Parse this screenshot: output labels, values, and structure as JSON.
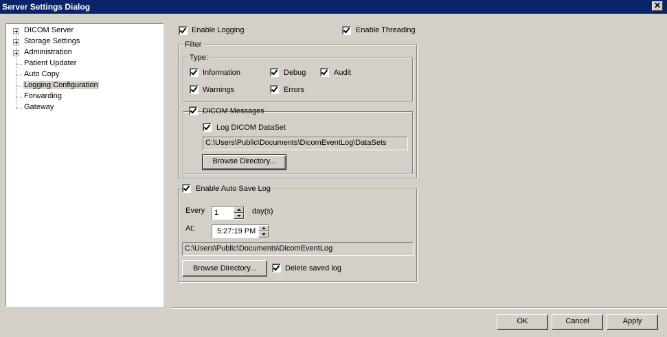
{
  "window": {
    "title": "Server Settings Dialog",
    "close": "✕"
  },
  "tree": {
    "items": [
      {
        "label": "DICOM Server",
        "expandable": true
      },
      {
        "label": "Storage Settings",
        "expandable": true
      },
      {
        "label": "Administration",
        "expandable": true
      },
      {
        "label": "Patient Updater",
        "expandable": false
      },
      {
        "label": "Auto Copy",
        "expandable": false
      },
      {
        "label": "Logging Configuration",
        "expandable": false,
        "selected": true
      },
      {
        "label": "Forwarding",
        "expandable": false
      },
      {
        "label": "Gateway",
        "expandable": false
      }
    ]
  },
  "logging": {
    "enable_logging": {
      "label": "Enable Logging",
      "checked": true
    },
    "enable_threading": {
      "label": "Enable Threading",
      "checked": true
    }
  },
  "filter": {
    "title": "Filter",
    "type_title": "Type:",
    "information": {
      "label": "Information",
      "checked": true
    },
    "debug": {
      "label": "Debug",
      "checked": true
    },
    "audit": {
      "label": "Audit",
      "checked": true
    },
    "warnings": {
      "label": "Warnings",
      "checked": true
    },
    "errors": {
      "label": "Errors",
      "checked": true
    },
    "dicom_messages": {
      "label": "DICOM Messages",
      "checked": true
    },
    "log_dataset": {
      "label": "Log DICOM DataSet",
      "checked": true
    },
    "dataset_path": "C:\\Users\\Public\\Documents\\DicomEventLog\\DataSets",
    "browse_label": "Browse Directory..."
  },
  "autosave": {
    "enable": {
      "label": "Enable Auto Save Log",
      "checked": true
    },
    "every_label": "Every",
    "every_value": "1",
    "days_label": "day(s)",
    "at_label": "At:",
    "at_value": "5:27:19 PM",
    "path": "C:\\Users\\Public\\Documents\\DicomEventLog",
    "browse_label": "Browse Directory...",
    "delete_saved": {
      "label": "Delete saved log",
      "checked": true
    }
  },
  "footer": {
    "ok": "OK",
    "cancel": "Cancel",
    "apply": "Apply"
  },
  "colors": {
    "titlebar": "#0a246a",
    "dialog": "#d4d0c8"
  }
}
